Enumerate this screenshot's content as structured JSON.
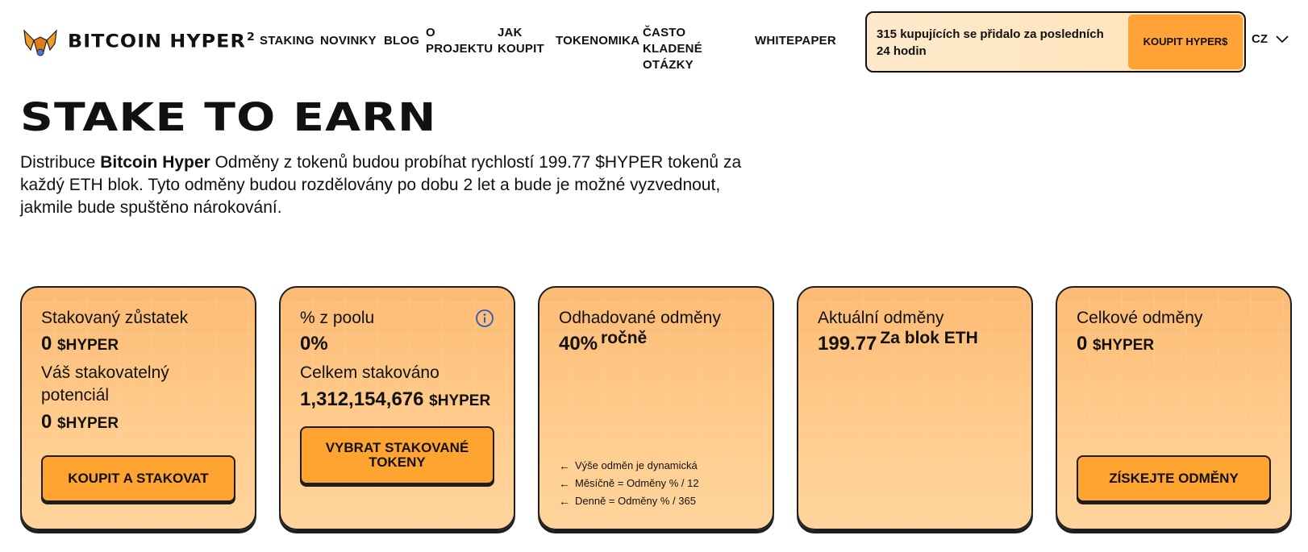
{
  "header": {
    "logo_text": "BITCOIN HYPER",
    "logo_sup": "2",
    "nav": [
      {
        "label": "STAKING"
      },
      {
        "label": "NOVINKY"
      },
      {
        "label": "BLOG"
      },
      {
        "label": "O PROJEKTU"
      },
      {
        "label": "JAK KOUPIT"
      },
      {
        "label": "TOKENOMIKA"
      },
      {
        "label": "ČASTO KLADENÉ OTÁZKY"
      },
      {
        "label": "WHITEPAPER"
      }
    ],
    "promo_text": "315 kupujících se přidalo za posledních 24 hodin",
    "promo_button": "KOUPIT HYPER$",
    "language": "CZ"
  },
  "hero": {
    "title": "STAKE TO EARN",
    "desc_pre": "Distribuce ",
    "desc_bold": "Bitcoin Hyper",
    "desc_post": " Odměny z tokenů budou probíhat rychlostí 199.77 $HYPER tokenů za každý ETH blok. Tyto odměny budou rozdělovány po dobu 2 let a bude je možné vyzvednout, jakmile bude spuštěno nárokování."
  },
  "cards": {
    "staked": {
      "label": "Stakovaný zůstatek",
      "value": "0",
      "unit": "$HYPER",
      "potential_label": "Váš stakovatelný potenciál",
      "potential_value": "0",
      "potential_unit": "$HYPER",
      "button": "KOUPIT A STAKOVAT"
    },
    "pool": {
      "label": "% z poolu",
      "value": "0%",
      "total_label": "Celkem stakováno",
      "total_value": "1,312,154,676",
      "total_unit": "$HYPER",
      "button": "VYBRAT STAKOVANÉ TOKENY"
    },
    "estimated": {
      "label": "Odhadované odměny",
      "value": "40%",
      "suffix": "ročně",
      "notes": [
        "Výše odměn je dynamická",
        "Měsíčně = Odměny % / 12",
        "Denně = Odměny % / 365"
      ]
    },
    "current": {
      "label": "Aktuální odměny",
      "value": "199.77",
      "suffix": "Za blok ETH"
    },
    "total": {
      "label": "Celkové odměny",
      "value": "0",
      "unit": "$HYPER",
      "button": "ZÍSKEJTE ODMĚNY"
    }
  },
  "colors": {
    "accent": "#ffa431",
    "card_top": "#fcbb74",
    "card_bottom": "#ffd49c",
    "info_icon": "#2d5cb8"
  }
}
